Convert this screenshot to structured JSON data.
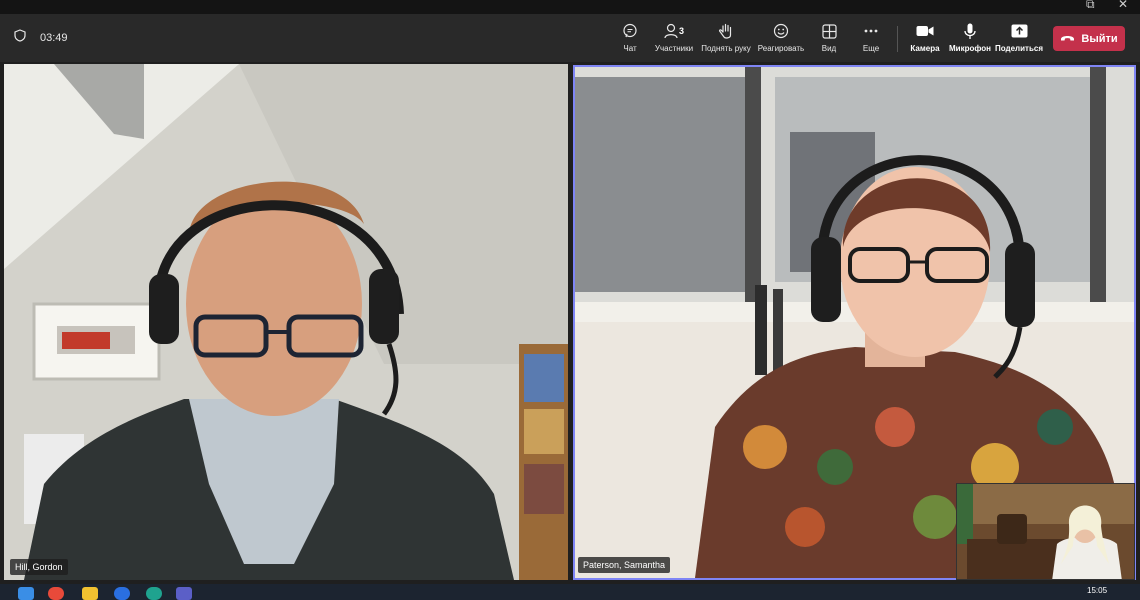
{
  "window": {
    "minimize_glyph": "⧉",
    "close_glyph": "✕"
  },
  "meeting": {
    "elapsed_time": "03:49"
  },
  "toolbar": {
    "chat_label": "Чат",
    "participants_label": "Участники",
    "participants_count": "3",
    "raise_hand_label": "Поднять руку",
    "react_label": "Реагировать",
    "view_label": "Вид",
    "more_label": "Еще",
    "camera_label": "Камера",
    "mic_label": "Микрофон",
    "share_label": "Поделиться",
    "leave_label": "Выйти"
  },
  "participants": [
    {
      "name": "Hill, Gordon"
    },
    {
      "name": "Paterson, Samantha"
    }
  ],
  "taskbar": {
    "time": "15:05"
  },
  "colors": {
    "accent": "#7f85f5",
    "leave": "#c4314b",
    "toolbar_bg": "#292929"
  },
  "icons": [
    "shield-icon",
    "chat-icon",
    "people-icon",
    "hand-icon",
    "smile-icon",
    "grid-icon",
    "more-icon",
    "camera-icon",
    "mic-icon",
    "share-icon",
    "phone-hangup-icon"
  ]
}
